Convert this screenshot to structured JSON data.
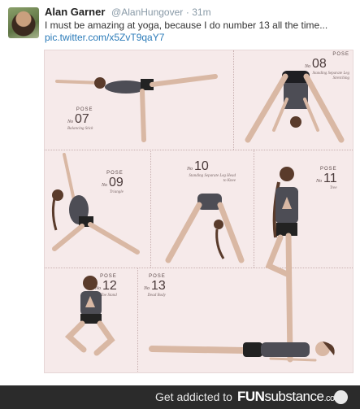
{
  "tweet": {
    "author_name": "Alan Garner",
    "author_handle": "@AlanHungover",
    "time": "· 31m",
    "text": "I must be amazing at yoga, because I do number 13 all the time...",
    "link": "pic.twitter.com/x5ZvT9qaY7"
  },
  "poster": {
    "pose_word": "POSE",
    "no_word": "No",
    "poses": [
      {
        "num": "07",
        "desc": "Balancing Stick"
      },
      {
        "num": "08",
        "desc": "Standing Separate Leg Stretching"
      },
      {
        "num": "09",
        "desc": "Triangle"
      },
      {
        "num": "10",
        "desc": "Standing Separate Leg Head to Knee"
      },
      {
        "num": "11",
        "desc": "Tree"
      },
      {
        "num": "12",
        "desc": "Toe Stand"
      },
      {
        "num": "13",
        "desc": "Dead Body"
      }
    ]
  },
  "footer": {
    "tagline": "Get addicted to",
    "brand_bold": "FUN",
    "brand_light": "substance",
    "brand_suffix": ".com"
  },
  "colors": {
    "poster_bg": "#f6eaea",
    "link": "#2b7bb9",
    "footer_bg": "#2b2b2b"
  }
}
